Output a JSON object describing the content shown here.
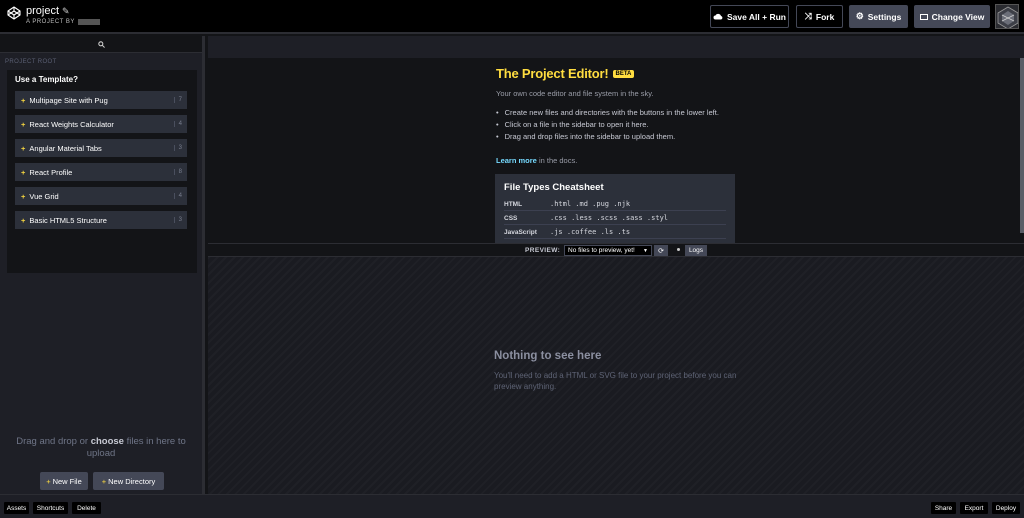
{
  "header": {
    "project_name": "project",
    "by_label": "A PROJECT BY",
    "buttons": {
      "save_all_run": "Save All + Run",
      "fork": "Fork",
      "settings": "Settings",
      "change_view": "Change View"
    }
  },
  "sidebar": {
    "search_icon": "search-icon",
    "root_label": "PROJECT ROOT",
    "templates_heading": "Use a Template?",
    "templates": [
      {
        "name": "Multipage Site with Pug",
        "count": "7"
      },
      {
        "name": "React Weights Calculator",
        "count": "4"
      },
      {
        "name": "Angular Material Tabs",
        "count": "3"
      },
      {
        "name": "React Profile",
        "count": "8"
      },
      {
        "name": "Vue Grid",
        "count": "4"
      },
      {
        "name": "Basic HTML5 Structure",
        "count": "3"
      }
    ],
    "drop_text_pre": "Drag and drop or",
    "drop_text_choose": "choose",
    "drop_text_post": "files in here to upload",
    "new_file": "New File",
    "new_directory": "New Directory"
  },
  "editor": {
    "title": "The Project Editor!",
    "badge": "BETA",
    "description": "Your own code editor and file system in the sky.",
    "bullets": [
      "Create new files and directories with the buttons in the lower left.",
      "Click on a file in the sidebar to open it here.",
      "Drag and drop files into the sidebar to upload them."
    ],
    "learn_more": "Learn more",
    "learn_more_suffix": "in the docs.",
    "cheatsheet": {
      "title": "File Types Cheatsheet",
      "rows": [
        {
          "lang": "HTML",
          "ext": ".html  .md  .pug  .njk"
        },
        {
          "lang": "CSS",
          "ext": ".css  .less  .scss  .sass  .styl"
        },
        {
          "lang": "JavaScript",
          "ext": ".js  .coffee  .ls  .ts"
        }
      ]
    }
  },
  "preview": {
    "label": "PREVIEW:",
    "select_value": "No files to preview, yet!",
    "logs": "Logs",
    "empty_title": "Nothing to see here",
    "empty_text": "You'll need to add a HTML or SVG file to your project before you can preview anything."
  },
  "footer": {
    "assets": "Assets",
    "shortcuts": "Shortcuts",
    "delete": "Delete",
    "share": "Share",
    "export": "Export",
    "deploy": "Deploy"
  },
  "colors": {
    "accent": "#ffdd40",
    "link": "#76daff",
    "button": "#444857"
  }
}
